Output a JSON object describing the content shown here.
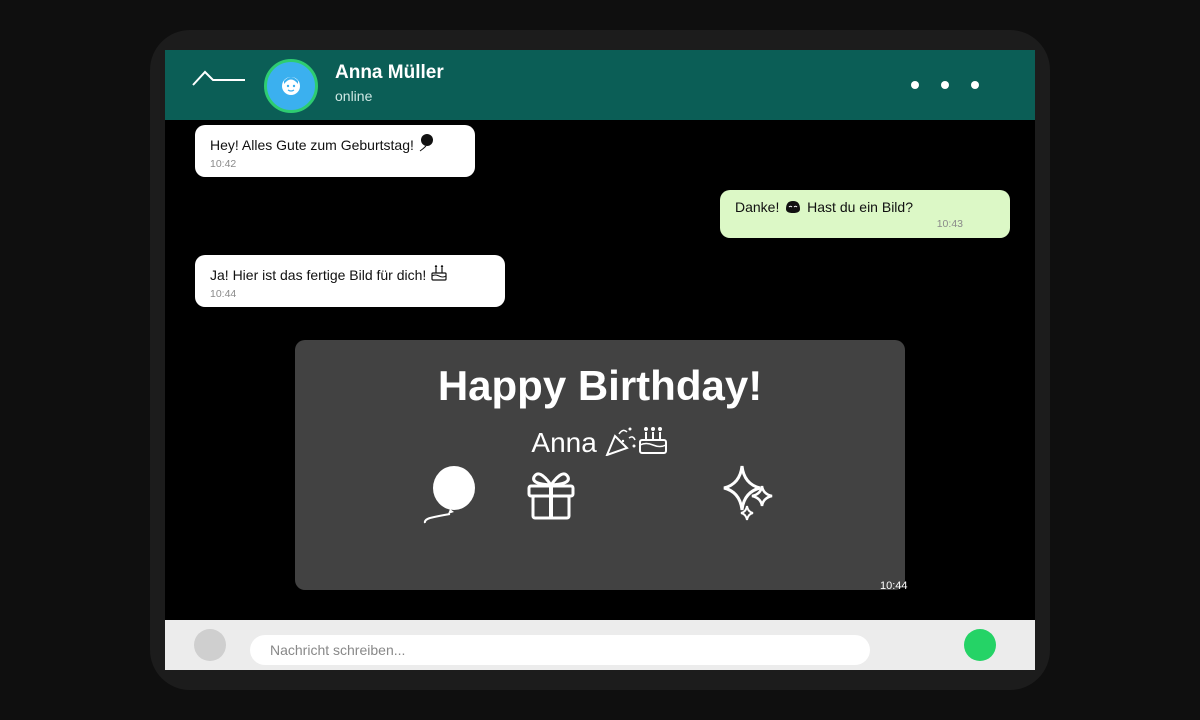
{
  "contact": {
    "name": "Anna Müller",
    "status": "online"
  },
  "messages": [
    {
      "direction": "incoming",
      "text": "Hey! Alles Gute zum Geburtstag!",
      "time": "10:42",
      "icon": "balloon-icon"
    },
    {
      "direction": "outgoing",
      "text_before": "Danke!",
      "text_after": "Hast du ein Bild?",
      "time": "10:43",
      "icon": "smiling-face-icon"
    },
    {
      "direction": "incoming",
      "text": "Ja! Hier ist das fertige Bild für dich!",
      "time": "10:44",
      "icon": "birthday-cake-icon"
    }
  ],
  "image_message": {
    "title": "Happy Birthday!",
    "subtitle": "Anna",
    "time": "10:44",
    "icons": [
      "party-popper-icon",
      "birthday-cake-icon",
      "balloon-icon",
      "gift-icon",
      "sparkles-icon"
    ]
  },
  "input": {
    "placeholder": "Nachricht schreiben..."
  },
  "colors": {
    "header": "#0b5e56",
    "avatar": "#3bb0ef",
    "avatar_ring": "#2ecc71",
    "incoming_bubble": "#ffffff",
    "outgoing_bubble": "#dcf8c6",
    "image_card": "#424242",
    "send_button": "#25d366"
  }
}
